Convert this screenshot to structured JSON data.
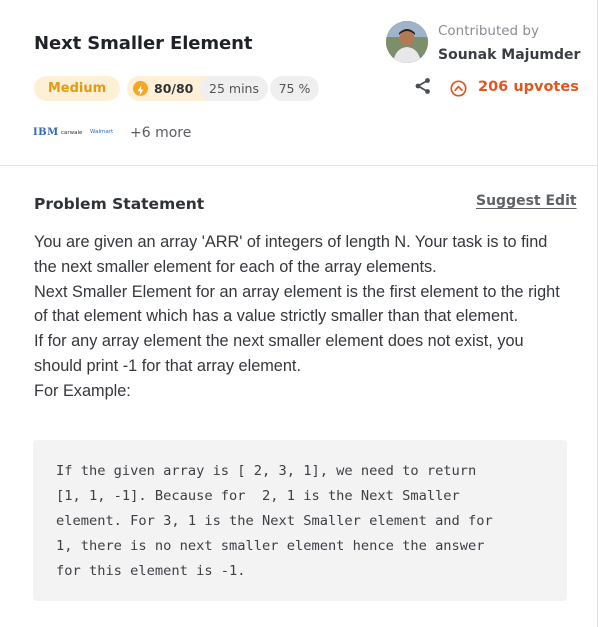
{
  "problem": {
    "title": "Next Smaller Element",
    "difficulty": "Medium",
    "score": "80/80",
    "time": "25 mins",
    "success_rate": "75 %",
    "upvotes": "206 upvotes"
  },
  "contributor": {
    "label": "Contributed by",
    "name": "Sounak Majumder"
  },
  "companies": {
    "logos": [
      "IBM",
      "carwale",
      "Walmart"
    ],
    "more": "+6 more"
  },
  "statement": {
    "heading": "Problem Statement",
    "suggest_edit": "Suggest Edit",
    "lines": [
      "You are given an array 'ARR' of integers of length N. Your task is to find the next smaller element for each of the array elements.",
      "Next Smaller Element for an array element is the first element to the right of that element which has a value strictly smaller than that element.",
      "If for any array element the next smaller element does not exist, you should print -1 for that array element.",
      "For Example:"
    ],
    "example_lines": [
      "If the given array is [ 2, 3, 1], we need to return",
      "[1, 1, -1]. Because for  2, 1 is the Next Smaller",
      "element. For 3, 1 is the Next Smaller element and for",
      "1, there is no next smaller element hence the answer",
      "for this element is -1."
    ]
  },
  "colors": {
    "accent": "#e2561f",
    "medium_text": "#e69a10",
    "chip_yellow": "#fdf0d6",
    "chip_gray": "#efefef"
  },
  "icons": [
    "lightning-icon",
    "share-icon",
    "upvote-icon"
  ]
}
